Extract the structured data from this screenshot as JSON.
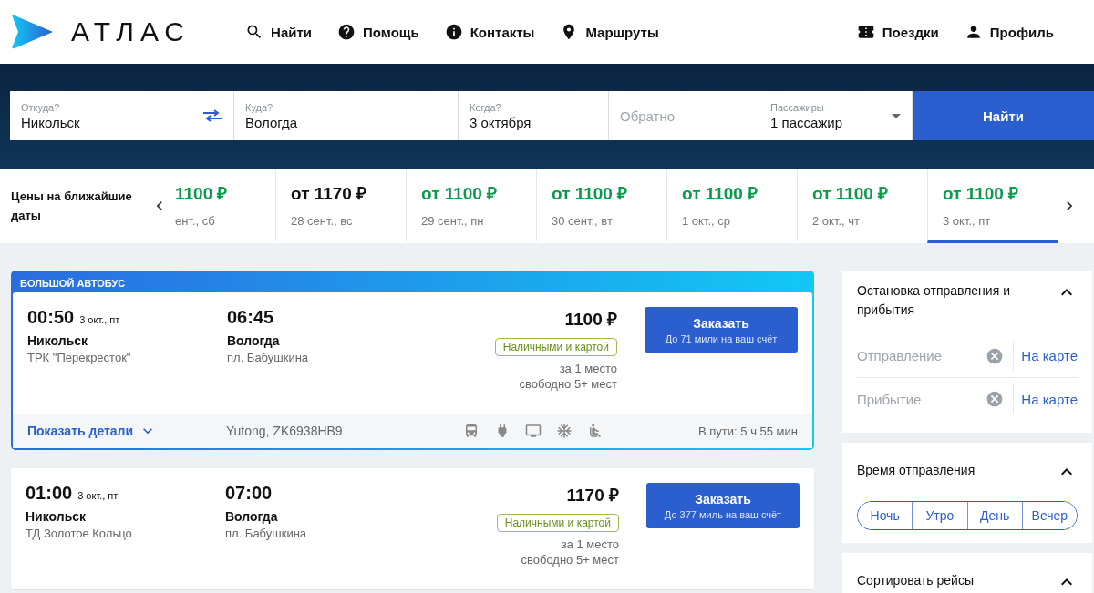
{
  "header": {
    "logo": "АТЛАС",
    "nav": [
      {
        "kind": "search",
        "label": "Найти"
      },
      {
        "kind": "help",
        "label": "Помощь"
      },
      {
        "kind": "info",
        "label": "Контакты"
      },
      {
        "kind": "pin",
        "label": "Маршруты"
      }
    ],
    "account": [
      {
        "kind": "ticket",
        "label": "Поездки"
      },
      {
        "kind": "person",
        "label": "Профиль"
      }
    ]
  },
  "search": {
    "fields": [
      {
        "kind": "from",
        "label": "Откуда?",
        "value": "Никольск"
      },
      {
        "kind": "to",
        "label": "Куда?",
        "value": "Вологда"
      },
      {
        "kind": "date",
        "label": "Когда?",
        "value": "3 октября"
      },
      {
        "kind": "return",
        "placeholder": "Обратно"
      },
      {
        "kind": "passengers",
        "label": "Пассажиры",
        "value": "1 пассажир"
      }
    ],
    "button": "Найти"
  },
  "price_strip": {
    "title": "Цены на ближайшие даты",
    "dates": [
      {
        "price": "1100 ₽",
        "date": "ент., сб",
        "cheapest": true,
        "selected": false
      },
      {
        "price": "от 1170 ₽",
        "date": "28 сент., вс",
        "cheapest": false,
        "selected": false
      },
      {
        "price": "от 1100 ₽",
        "date": "29 сент., пн",
        "cheapest": true,
        "selected": false
      },
      {
        "price": "от 1100 ₽",
        "date": "30 сент., вт",
        "cheapest": true,
        "selected": false
      },
      {
        "price": "от 1100 ₽",
        "date": "1 окт., ср",
        "cheapest": true,
        "selected": false
      },
      {
        "price": "от 1100 ₽",
        "date": "2 окт., чт",
        "cheapest": true,
        "selected": false
      },
      {
        "price": "от 1100 ₽",
        "date": "3 окт., пт",
        "cheapest": true,
        "selected": true
      }
    ]
  },
  "trips": [
    {
      "badge": "БОЛЬШОЙ АВТОБУС",
      "depart_time": "00:50",
      "depart_date": "3 окт., пт",
      "from_city": "Никольск",
      "from_stop": "ТРК \"Перекресток\"",
      "arrive_time": "06:45",
      "to_city": "Вологда",
      "to_stop": "пл. Бабушкина",
      "price": "1100 ₽",
      "payment": "Наличными и картой",
      "per": "за 1 место",
      "seats": "свободно 5+ мест",
      "button": "Заказать",
      "miles": "До 71 мили на ваш счёт",
      "footer": {
        "details": "Показать детали",
        "bus": "Yutong, ZK6938HB9",
        "amenities": [
          {
            "kind": "bus"
          },
          {
            "kind": "plug"
          },
          {
            "kind": "tv"
          },
          {
            "kind": "ac"
          },
          {
            "kind": "seat"
          }
        ],
        "duration": "В пути: 5 ч 55 мин"
      }
    },
    {
      "depart_time": "01:00",
      "depart_date": "3 окт., пт",
      "from_city": "Никольск",
      "from_stop": "ТД Золотое Кольцо",
      "arrive_time": "07:00",
      "to_city": "Вологда",
      "to_stop": "пл. Бабушкина",
      "price": "1170 ₽",
      "payment": "Наличными и картой",
      "per": "за 1 место",
      "seats": "свободно 5+ мест",
      "button": "Заказать",
      "miles": "До 377 миль на ваш счёт"
    }
  ],
  "filters": [
    {
      "kind": "stops",
      "title": "Остановка отправления и прибытия",
      "expanded": true,
      "rows": [
        {
          "placeholder": "Отправление",
          "link": "На карте"
        },
        {
          "placeholder": "Прибытие",
          "link": "На карте"
        }
      ]
    },
    {
      "kind": "time",
      "title": "Время отправления",
      "expanded": true,
      "options": [
        {
          "label": "Ночь",
          "selected": false
        },
        {
          "label": "Утро",
          "selected": false
        },
        {
          "label": "День",
          "selected": false
        },
        {
          "label": "Вечер",
          "selected": false
        }
      ]
    },
    {
      "kind": "sort",
      "title": "Сортировать рейсы",
      "expanded": true
    }
  ]
}
